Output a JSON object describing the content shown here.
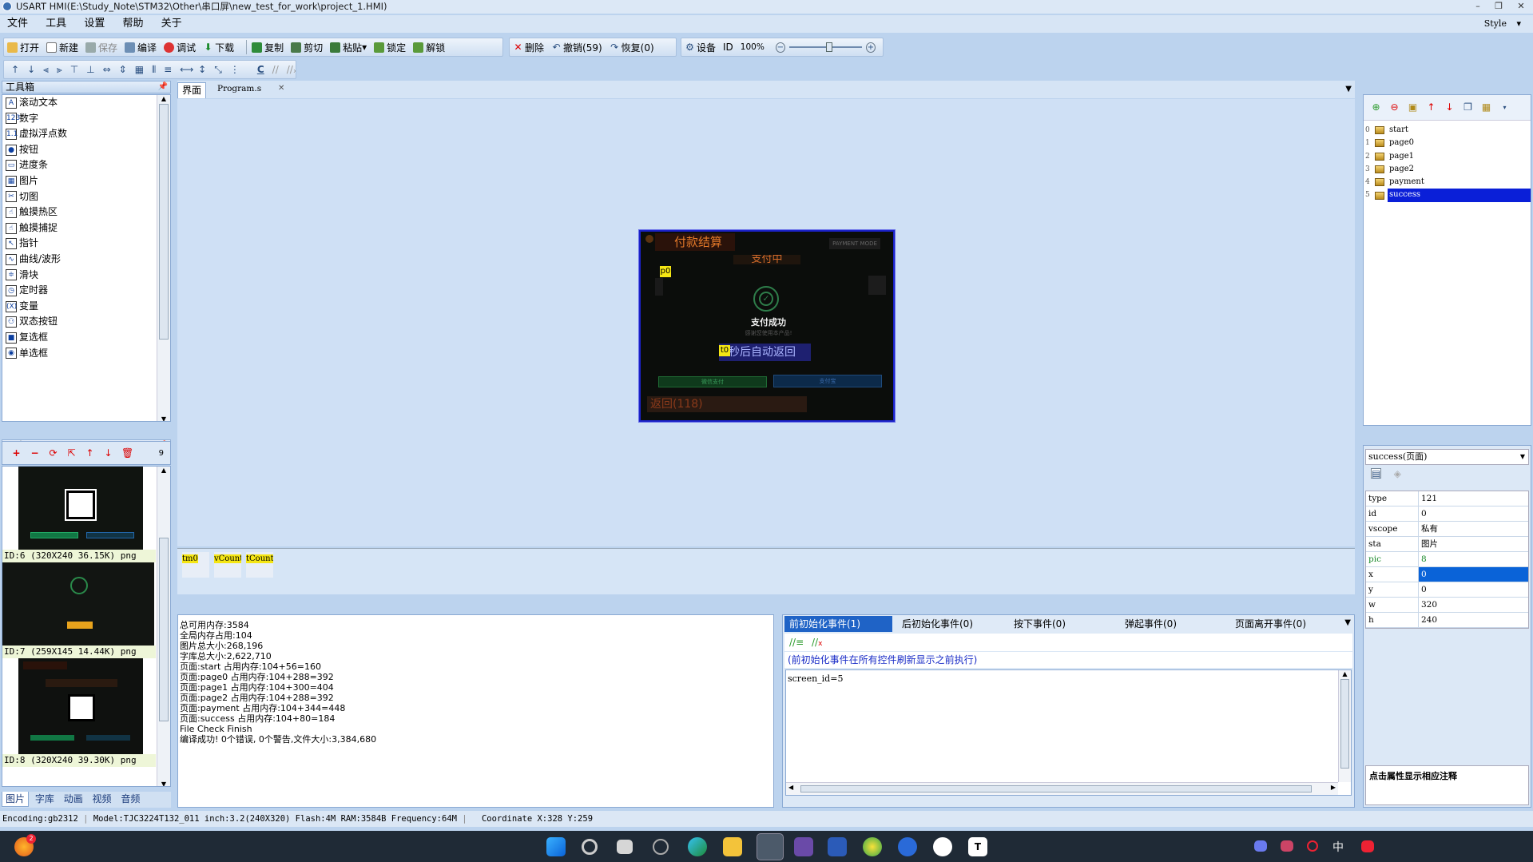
{
  "window": {
    "title": "USART HMI(E:\\Study_Note\\STM32\\Other\\串口屏\\new_test_for_work\\project_1.HMI)"
  },
  "menu": {
    "items": [
      "文件",
      "工具",
      "设置",
      "帮助",
      "关于"
    ],
    "style": "Style"
  },
  "toolbar": {
    "open": "打开",
    "new": "新建",
    "save": "保存",
    "compile": "编译",
    "debug": "调试",
    "download": "下载",
    "copy": "复制",
    "cut": "剪切",
    "paste": "粘贴",
    "lock": "锁定",
    "unlock": "解锁",
    "delete": "删除",
    "undo": "撤销(59)",
    "redo": "恢复(0)",
    "settings": "设备",
    "id": "ID",
    "zoom": "100%",
    "c_label": "C"
  },
  "toolbox": {
    "title": "工具箱",
    "items": [
      {
        "label": "滚动文本",
        "icon": "A"
      },
      {
        "label": "数字",
        "icon": "123"
      },
      {
        "label": "虚拟浮点数",
        "icon": "1.1"
      },
      {
        "label": "按钮",
        "icon": "●"
      },
      {
        "label": "进度条",
        "icon": "▭"
      },
      {
        "label": "图片",
        "icon": "▦"
      },
      {
        "label": "切图",
        "icon": "✂"
      },
      {
        "label": "触摸热区",
        "icon": "☝"
      },
      {
        "label": "触摸捕捉",
        "icon": "☝"
      },
      {
        "label": "指针",
        "icon": "↖"
      },
      {
        "label": "曲线/波形",
        "icon": "∿"
      },
      {
        "label": "滑块",
        "icon": "≑"
      },
      {
        "label": "定时器",
        "icon": "◷"
      },
      {
        "label": "变量",
        "icon": "(X)"
      },
      {
        "label": "双态按钮",
        "icon": "⚇"
      },
      {
        "label": "复选框",
        "icon": "■"
      },
      {
        "label": "单选框",
        "icon": "◉"
      }
    ]
  },
  "images": {
    "title": "图片",
    "count": "9",
    "items": [
      {
        "label": "ID:6  (320X240 36.15K) png"
      },
      {
        "label": "ID:7  (259X145 14.44K) png"
      },
      {
        "label": "ID:8  (320X240 39.30K) png"
      }
    ],
    "bottom_tabs": [
      "图片",
      "字库",
      "动画",
      "视频",
      "音频"
    ]
  },
  "editor": {
    "tabs": [
      "界面",
      "Program.s"
    ],
    "preview": {
      "header": "付款结算",
      "mode": "PAYMENT MODE",
      "paying": "支付中",
      "p0": "p0",
      "success": "支付成功",
      "hint": "感谢您使用本产品!",
      "t0": "t0",
      "auto_return": "秒后自动返回",
      "btn_left": "微信支付",
      "btn_right": "支付宝",
      "back": "返回(118)"
    },
    "components": [
      "tm0",
      "vCount",
      "tCount"
    ]
  },
  "output": {
    "title": "输出",
    "lines": [
      "总可用内存:3584",
      "全局内存占用:104",
      "图片总大小:268,196",
      "字库总大小:2,622,710",
      "页面:start 占用内存:104+56=160",
      "页面:page0 占用内存:104+288=392",
      "页面:page1 占用内存:104+300=404",
      "页面:page2 占用内存:104+288=392",
      "页面:payment 占用内存:104+344=448",
      "页面:success 占用内存:104+80=184",
      "File Check Finish",
      "编译成功! 0个错误, 0个警告,文件大小:3,384,680"
    ]
  },
  "events": {
    "title": "事件",
    "tabs": [
      "前初始化事件(1)",
      "后初始化事件(0)",
      "按下事件(0)",
      "弹起事件(0)",
      "页面离开事件(0)"
    ],
    "description": "(前初始化事件在所有控件刷新显示之前执行)",
    "code": "screen_id=5"
  },
  "pages": {
    "title": "页面",
    "items": [
      {
        "num": "0",
        "name": "start"
      },
      {
        "num": "1",
        "name": "page0"
      },
      {
        "num": "2",
        "name": "page1"
      },
      {
        "num": "3",
        "name": "page2"
      },
      {
        "num": "4",
        "name": "payment"
      },
      {
        "num": "5",
        "name": "success"
      }
    ],
    "selected": 5
  },
  "properties": {
    "title": "属性",
    "selector": "success(页面)",
    "rows": [
      {
        "k": "type",
        "v": "121"
      },
      {
        "k": "id",
        "v": "0"
      },
      {
        "k": "vscope",
        "v": "私有"
      },
      {
        "k": "sta",
        "v": "图片"
      },
      {
        "k": "pic",
        "v": "8"
      },
      {
        "k": "x",
        "v": "0"
      },
      {
        "k": "y",
        "v": "0"
      },
      {
        "k": "w",
        "v": "320"
      },
      {
        "k": "h",
        "v": "240"
      }
    ],
    "hint": "点击属性显示相应注释"
  },
  "status": {
    "encoding": "Encoding:gb2312",
    "model": "Model:TJC3224T132_011  inch:3.2(240X320) Flash:4M RAM:3584B Frequency:64M",
    "coord": "Coordinate X:328  Y:259"
  },
  "taskbar": {
    "badge": "2",
    "ime": "中"
  },
  "colors": {
    "accent": "#0a1fd8",
    "panelBorder": "#8aa9d3"
  }
}
